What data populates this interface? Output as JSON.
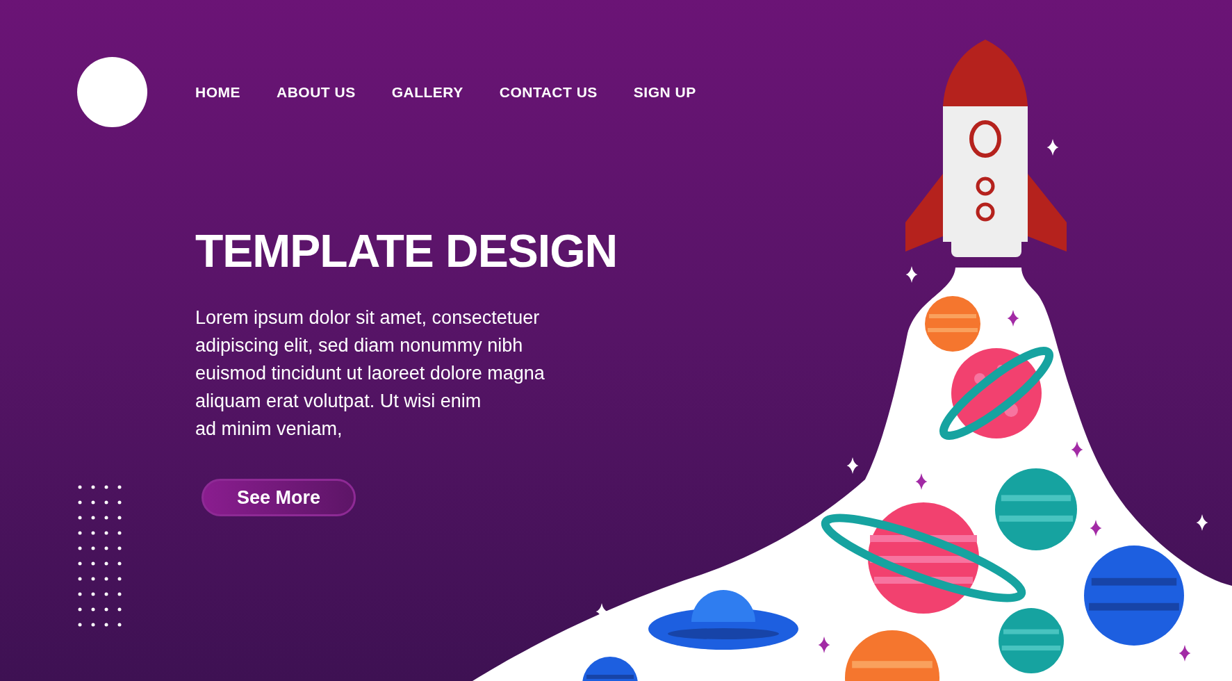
{
  "nav": [
    {
      "label": "HOME"
    },
    {
      "label": "ABOUT US"
    },
    {
      "label": "GALLERY"
    },
    {
      "label": "CONTACT US"
    },
    {
      "label": "SIGN UP"
    }
  ],
  "hero": {
    "title": "TEMPLATE DESIGN",
    "text": "Lorem ipsum dolor sit amet, consectetuer\nadipiscing elit, sed diam nonummy nibh\neuismod tincidunt ut laoreet dolore magna\naliquam erat volutpat. Ut wisi enim\nad minim veniam,",
    "button": "See More"
  }
}
